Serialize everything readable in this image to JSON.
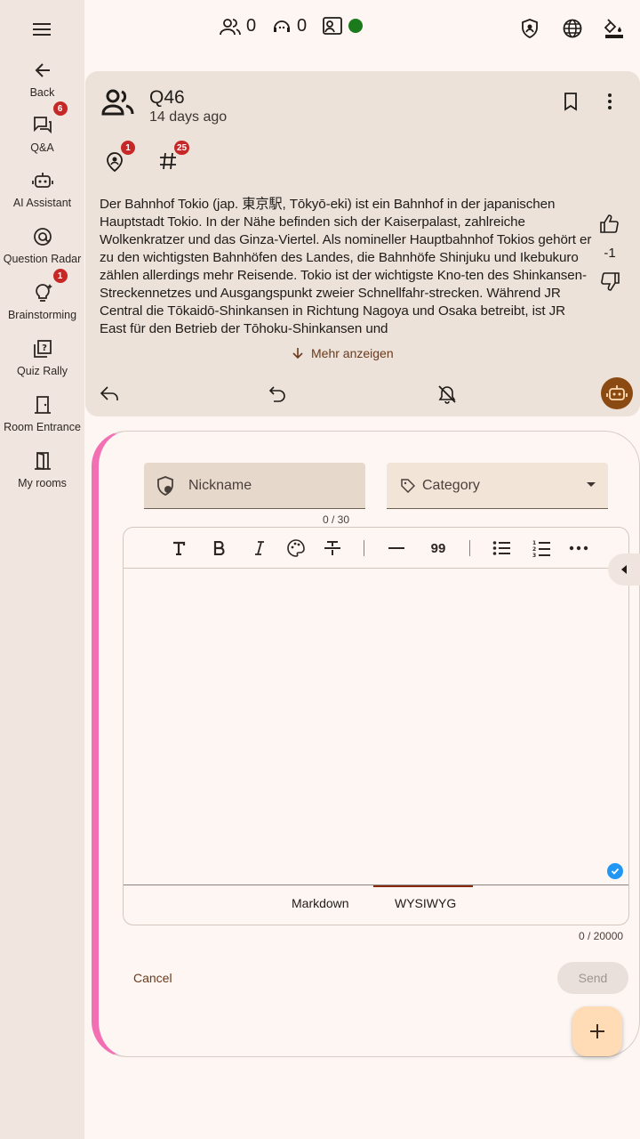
{
  "sidebar": {
    "items": [
      {
        "label": "Back",
        "icon": "arrow-left-icon"
      },
      {
        "label": "Q&A",
        "icon": "forum-icon",
        "badge": "6"
      },
      {
        "label": "AI Assistant",
        "icon": "robot-icon"
      },
      {
        "label": "Question Radar",
        "icon": "radar-icon"
      },
      {
        "label": "Brainstorming",
        "icon": "lightbulb-icon",
        "badge": "1"
      },
      {
        "label": "Quiz Rally",
        "icon": "quiz-icon"
      },
      {
        "label": "Room Entrance",
        "icon": "door-icon"
      },
      {
        "label": "My rooms",
        "icon": "door-open-icon"
      }
    ]
  },
  "topbar": {
    "participants": "0",
    "moderators": "0",
    "presenter_status_color": "#1b7a1b"
  },
  "question": {
    "title": "Q46",
    "time": "14 days ago",
    "badge_people": "1",
    "badge_tags": "25",
    "body": "Der Bahnhof Tokio (jap. 東京駅, Tōkyō-eki) ist ein Bahnhof in der japanischen Hauptstadt Tokio. In der Nähe befinden sich der Kaiserpalast, zahlreiche Wolkenkratzer und das Ginza-Viertel. Als nomineller Hauptbahnhof Tokios gehört er zu den wichtigsten Bahnhöfen des Landes, die Bahnhöfe Shinjuku und Ikebukuro zählen allerdings mehr Reisende. Tokio ist der wichtigste Kno-ten des Shinkansen-Streckennetzes und Ausgangspunkt zweier Schnellfahr-strecken. Während JR Central die Tōkaidō-Shinkansen in Richtung Nagoya und Osaka betreibt, ist JR East für den Betrieb der Tōhoku-Shinkansen und",
    "show_more": "Mehr anzeigen",
    "score": "-1"
  },
  "compose": {
    "nickname_placeholder": "Nickname",
    "category_placeholder": "Category",
    "nickname_count": "0 / 30",
    "quote_glyph": "99",
    "mode_markdown": "Markdown",
    "mode_wysiwyg": "WYSIWYG",
    "body_count": "0 / 20000",
    "cancel": "Cancel",
    "send": "Send"
  },
  "colors": {
    "accent_pink": "#f36fb3",
    "badge_red": "#c62828",
    "brown": "#8a4a12"
  }
}
